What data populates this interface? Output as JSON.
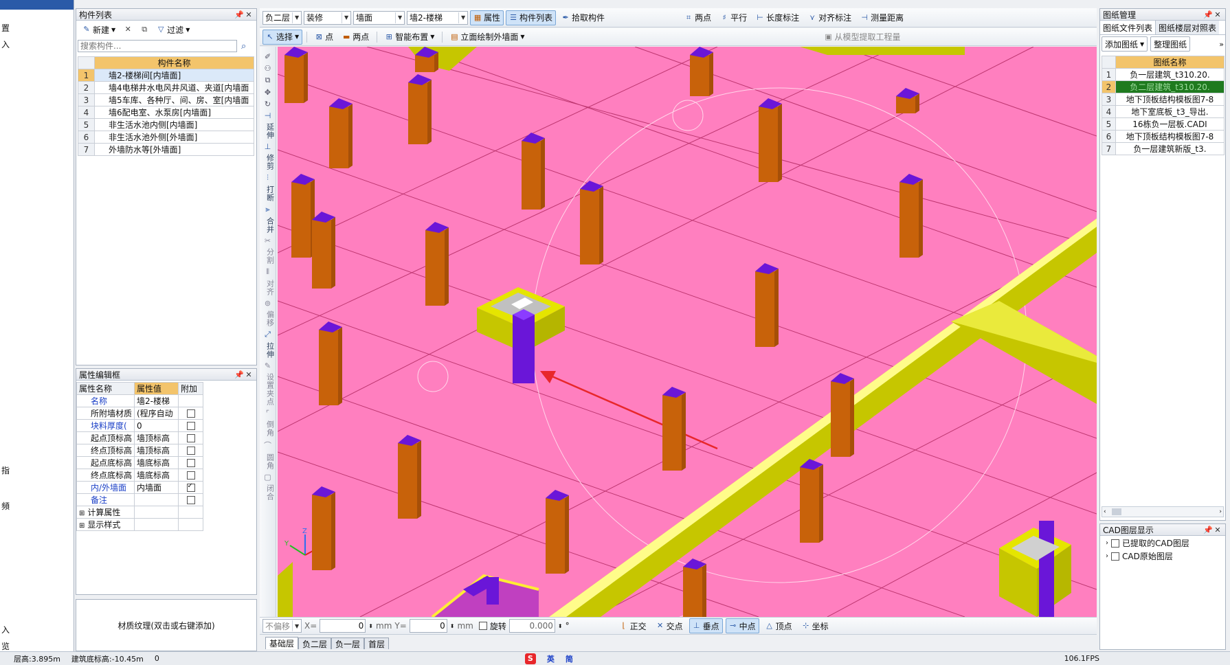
{
  "left_edge": {
    "items": [
      "置",
      "入",
      "指",
      "頻",
      "入",
      "览"
    ]
  },
  "component_list": {
    "title": "构件列表",
    "toolbar": {
      "new_label": "新建",
      "filter_label": "过滤"
    },
    "search_placeholder": "搜索构件...",
    "column_header": "构件名称",
    "rows": [
      {
        "num": "1",
        "name": "墙2-楼梯间[内墙面]"
      },
      {
        "num": "2",
        "name": "墙4电梯井水电风井风道、夹道[内墙面"
      },
      {
        "num": "3",
        "name": "墙5车库、各种厅、间、房、室[内墙面"
      },
      {
        "num": "4",
        "name": "墙6配电室、水泵房[内墙面]"
      },
      {
        "num": "5",
        "name": "非生活水池内侧[内墙面]"
      },
      {
        "num": "6",
        "name": "非生活水池外侧[外墙面]"
      },
      {
        "num": "7",
        "name": "外墙防水等[外墙面]"
      }
    ]
  },
  "property_editor": {
    "title": "属性编辑框",
    "headers": [
      "属性名称",
      "属性值",
      "附加"
    ],
    "rows": [
      {
        "name": "名称",
        "value": "墙2-楼梯",
        "check": null,
        "blue": true
      },
      {
        "name": "所附墙材质",
        "value": "(程序自动",
        "check": false,
        "blue": false
      },
      {
        "name": "块料厚度(",
        "value": "0",
        "check": false,
        "blue": true
      },
      {
        "name": "起点顶标高",
        "value": "墙顶标高",
        "check": false,
        "blue": false
      },
      {
        "name": "终点顶标高",
        "value": "墙顶标高",
        "check": false,
        "blue": false
      },
      {
        "name": "起点底标高",
        "value": "墙底标高",
        "check": false,
        "blue": false
      },
      {
        "name": "终点底标高",
        "value": "墙底标高",
        "check": false,
        "blue": false
      },
      {
        "name": "内/外墙面",
        "value": "内墙面",
        "check": true,
        "blue": true
      },
      {
        "name": "备注",
        "value": "",
        "check": false,
        "blue": true
      }
    ],
    "groups": [
      "计算属性",
      "显示样式"
    ],
    "material_hint": "材质纹理(双击或右键添加)"
  },
  "toolbar_row1": {
    "floor": "负二层",
    "category": "装修",
    "type": "墙面",
    "component": "墙2-楼梯",
    "attr_label": "属性",
    "list_label": "构件列表",
    "pick_label": "拾取构件",
    "two_points": "两点",
    "parallel": "平行",
    "length_dim": "长度标注",
    "align_dim": "对齐标注",
    "measure": "测量距离"
  },
  "toolbar_row2": {
    "select": "选择",
    "point": "点",
    "two_points": "两点",
    "smart_place": "智能布置",
    "elev_draw": "立面绘制外墙面",
    "extract": "从模型提取工程量"
  },
  "vertical_tools": [
    "延伸",
    "修剪",
    "打断",
    "合并",
    "分割",
    "对齐",
    "偏移",
    "拉伸",
    "设置夹点",
    "倒角",
    "圆角",
    "闭合"
  ],
  "bottom_bar": {
    "offset_label": "不偏移",
    "x_label": "X=",
    "x_value": "0",
    "y_label": "Y=",
    "y_value": "0",
    "unit": "mm",
    "rotate": "旋转",
    "rotate_value": "0.000",
    "deg": "°",
    "snaps": [
      {
        "label": "正交",
        "active": false
      },
      {
        "label": "交点",
        "active": false
      },
      {
        "label": "垂点",
        "active": true
      },
      {
        "label": "中点",
        "active": true
      },
      {
        "label": "顶点",
        "active": false
      },
      {
        "label": "坐标",
        "active": false
      }
    ]
  },
  "floor_tabs": [
    "基础层",
    "负二层",
    "负一层",
    "首层"
  ],
  "drawing_manager": {
    "title": "图纸管理",
    "tabs": [
      "图纸文件列表",
      "图纸楼层对照表"
    ],
    "add_label": "添加图纸",
    "organize_label": "整理图纸",
    "column_header": "图纸名称",
    "rows": [
      {
        "num": "1",
        "name": "负一层建筑_t310.20."
      },
      {
        "num": "2",
        "name": "负二层建筑_t310.20."
      },
      {
        "num": "3",
        "name": "地下顶板结构模板图7-8"
      },
      {
        "num": "4",
        "name": "地下室底板_t3_导出."
      },
      {
        "num": "5",
        "name": "16栋负一层板.CADI"
      },
      {
        "num": "6",
        "name": "地下顶板结构模板图7-8"
      },
      {
        "num": "7",
        "name": "负一层建筑新版_t3."
      }
    ],
    "selected_index": 1
  },
  "cad_layers": {
    "title": "CAD图层显示",
    "items": [
      "已提取的CAD图层",
      "CAD原始图层"
    ]
  },
  "status_bar": {
    "floor_height": "层高:3.895m",
    "base_elev": "建筑底标高:-10.45m",
    "extra": "0",
    "ime_label": "英",
    "ime_mode": "简",
    "fps": "106.1FPS"
  },
  "colors": {
    "slab": "#ff7fbf",
    "column": "#c8620a",
    "column_top": "#6a16d8",
    "beam": "#c6c600",
    "highlight": "#6a16d8",
    "arrow": "#e8272b",
    "accent_select": "#1f7a1f"
  }
}
